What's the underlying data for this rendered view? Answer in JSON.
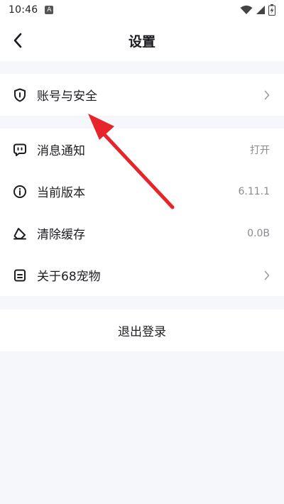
{
  "status_bar": {
    "time": "10:46",
    "notification_glyph": "A",
    "icons": [
      "wifi-icon",
      "signal-icon",
      "battery-charging-icon"
    ]
  },
  "header": {
    "title": "设置",
    "back_icon": "chevron-left-icon"
  },
  "group_account": {
    "items": [
      {
        "label": "账号与安全",
        "icon": "shield-icon",
        "trailing": "chevron-right-icon"
      }
    ]
  },
  "group_main": {
    "items": [
      {
        "label": "消息通知",
        "icon": "message-bubble-icon",
        "value": "打开"
      },
      {
        "label": "当前版本",
        "icon": "info-icon",
        "value": "6.11.1"
      },
      {
        "label": "清除缓存",
        "icon": "eraser-icon",
        "value": "0.0B"
      },
      {
        "label": "关于68宠物",
        "icon": "document-icon",
        "trailing": "chevron-right-icon"
      }
    ]
  },
  "logout": {
    "label": "退出登录"
  },
  "annotation": {
    "icon": "red-arrow-icon",
    "color": "#e8242b"
  },
  "colors": {
    "background": "#f6f7fb",
    "card": "#ffffff",
    "text": "#1d1d22",
    "secondary_text": "#8a8a92"
  }
}
